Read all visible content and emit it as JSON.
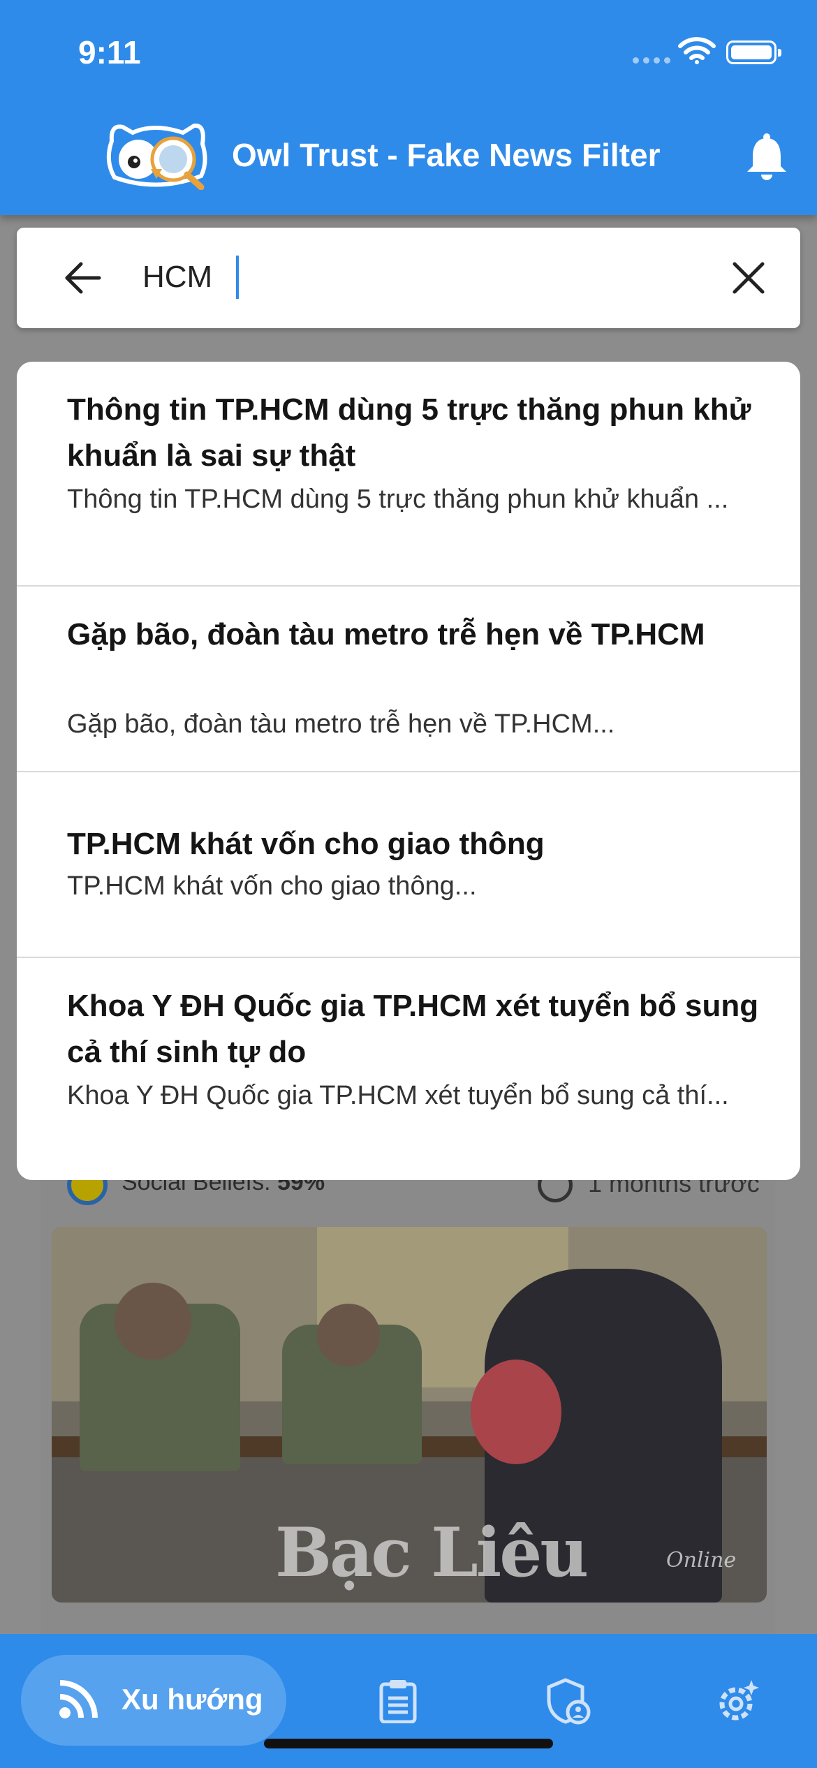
{
  "status_bar": {
    "time": "9:11"
  },
  "header": {
    "title": "Owl Trust - Fake News Filter",
    "logo_icon": "owl-magnifier-logo",
    "notification_icon": "bell-icon",
    "background_color": "#2f8bea"
  },
  "search": {
    "value": "HCM",
    "back_icon": "arrow-left-icon",
    "clear_icon": "close-icon"
  },
  "suggestions": [
    {
      "title": "Thông tin TP.HCM dùng 5 trực thăng phun khử khuẩn là sai sự thật",
      "description": "Thông tin TP.HCM dùng 5 trực thăng phun khử khuẩn ..."
    },
    {
      "title": "Gặp bão, đoàn tàu metro trễ hẹn về TP.HCM",
      "description": "Gặp bão, đoàn tàu metro trễ hẹn về TP.HCM..."
    },
    {
      "title": "TP.HCM khát vốn cho giao thông",
      "description": "TP.HCM khát vốn cho giao thông..."
    },
    {
      "title": "Khoa Y ĐH Quốc gia TP.HCM xét tuyển bổ sung cả thí sinh tự do",
      "description": "Khoa Y ĐH Quốc gia TP.HCM xét tuyển bổ sung cả thí..."
    }
  ],
  "feed": {
    "beliefs_label": "Social Beliefs:",
    "beliefs_value": "59%",
    "time_ago": "1 months trước",
    "image_watermark": "Bạc Liêu",
    "image_watermark_sub": "Online"
  },
  "bottom_nav": {
    "active_label": "Xu hướng",
    "items": [
      "rss-icon",
      "clipboard-icon",
      "shield-user-icon",
      "gear-icon"
    ]
  }
}
